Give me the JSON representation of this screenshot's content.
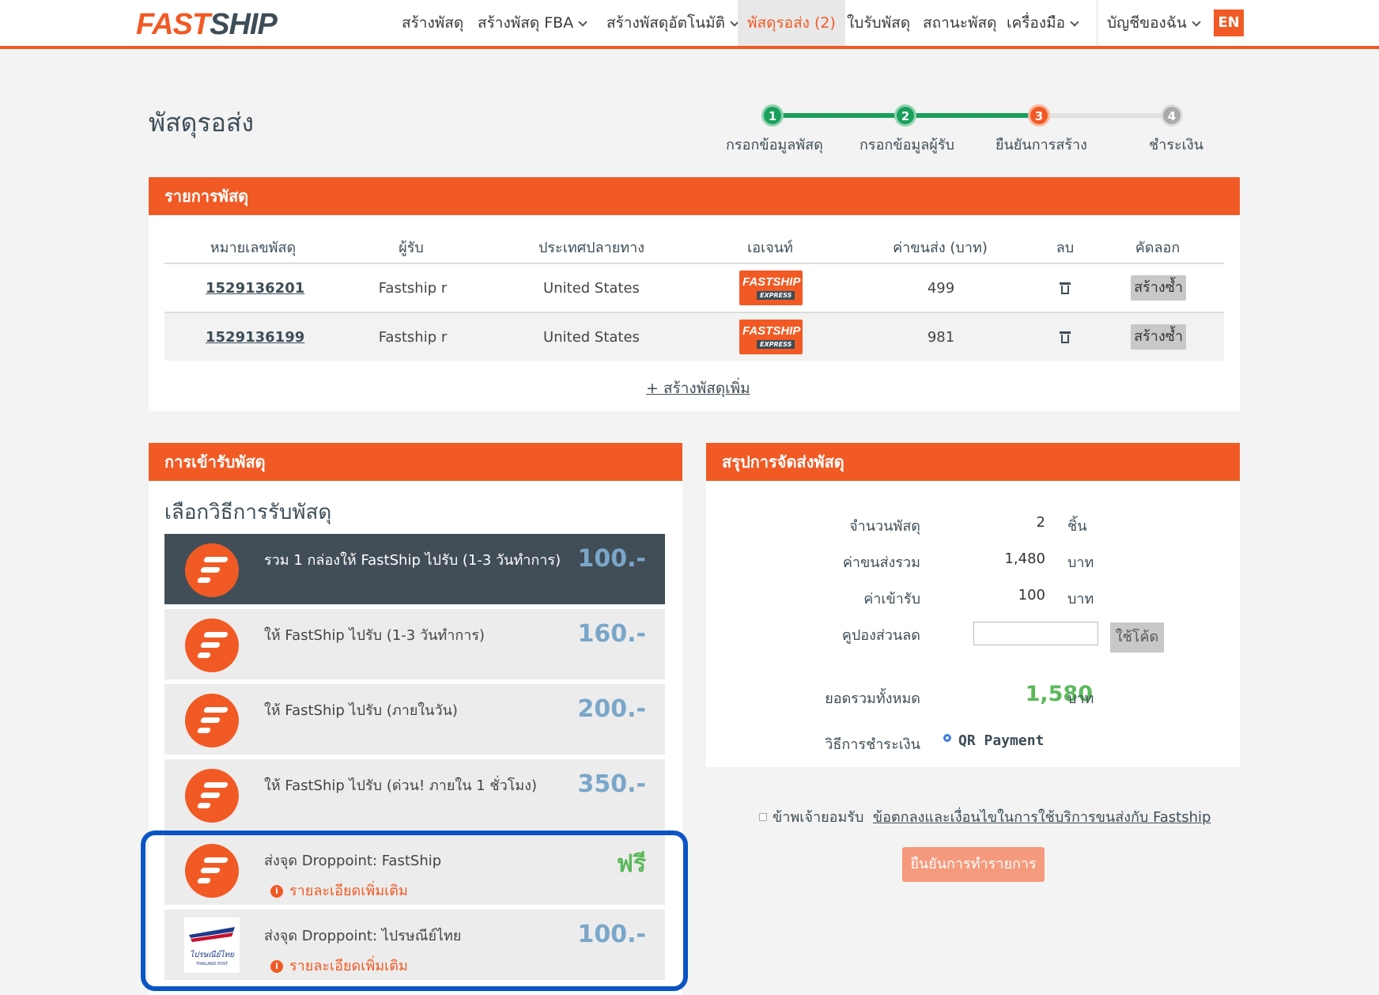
{
  "brand": {
    "logo_part1": "FAST",
    "logo_part2": "SHIP",
    "accent": "#f15a24",
    "dark": "#3d4d57",
    "success": "#5cb85c"
  },
  "nav": {
    "items": [
      {
        "label": "สร้างพัสดุ"
      },
      {
        "label": "สร้างพัสดุ FBA"
      },
      {
        "label": "สร้างพัสดุอัตโนมัติ"
      },
      {
        "label": "พัสดุรอส่ง (2)"
      },
      {
        "label": "ใบรับพัสดุ"
      },
      {
        "label": "สถานะพัสดุ"
      },
      {
        "label": "เครื่องมือ"
      },
      {
        "label": "บัญชีของฉัน"
      }
    ],
    "lang": "EN"
  },
  "page": {
    "title": "พัสดุรอส่ง"
  },
  "stepper": {
    "steps": [
      {
        "num": "1",
        "label": "กรอกข้อมูลพัสดุ"
      },
      {
        "num": "2",
        "label": "กรอกข้อมูลผู้รับ"
      },
      {
        "num": "3",
        "label": "ยืนยันการสร้าง"
      },
      {
        "num": "4",
        "label": "ชำระเงิน"
      }
    ]
  },
  "parcels": {
    "title": "รายการพัสดุ",
    "headers": [
      "หมายเลขพัสดุ",
      "ผู้รับ",
      "ประเทศปลายทาง",
      "เอเจนท์",
      "ค่าขนส่ง (บาท)",
      "ลบ",
      "คัดลอก"
    ],
    "rows": [
      {
        "id": "1529136201",
        "recipient": "Fastship r",
        "country": "United States",
        "agent_top": "FASTSHIP",
        "agent_bottom": "EXPRESS",
        "cost": "499",
        "copy": "สร้างซ้ำ"
      },
      {
        "id": "1529136199",
        "recipient": "Fastship r",
        "country": "United States",
        "agent_top": "FASTSHIP",
        "agent_bottom": "EXPRESS",
        "cost": "981",
        "copy": "สร้างซ้ำ"
      }
    ],
    "add_more": "+ สร้างพัสดุเพิ่ม"
  },
  "pickup": {
    "title": "การเข้ารับพัสดุ",
    "subtitle": "เลือกวิธีการรับพัสดุ",
    "options": [
      {
        "label": "รวม 1 กล่องให้ FastShip ไปรับ (1-3 วันทำการ)",
        "price": "100.-"
      },
      {
        "label": "ให้ FastShip ไปรับ (1-3 วันทำการ)",
        "price": "160.-"
      },
      {
        "label": "ให้ FastShip ไปรับ (ภายในวัน)",
        "price": "200.-"
      },
      {
        "label": "ให้ FastShip ไปรับ (ด่วน! ภายใน 1 ชั่วโมง)",
        "price": "350.-"
      },
      {
        "label": "ส่งจุด Droppoint: FastShip",
        "price": "ฟรี",
        "more": "รายละเอียดเพิ่มเติม"
      },
      {
        "label": "ส่งจุด Droppoint: ไปรษณีย์ไทย",
        "price": "100.-",
        "more": "รายละเอียดเพิ่มเติม",
        "logo_text": "ไปรษณีย์ไทย",
        "logo_sub": "THAILAND POST"
      }
    ],
    "info_icon": "i"
  },
  "summary": {
    "title": "สรุปการจัดส่งพัสดุ",
    "count_label": "จำนวนพัสดุ",
    "count_value": "2",
    "count_unit": "ชิ้น",
    "shipping_label": "ค่าขนส่งรวม",
    "shipping_value": "1,480",
    "shipping_unit": "บาท",
    "pickup_label": "ค่าเข้ารับ",
    "pickup_value": "100",
    "pickup_unit": "บาท",
    "coupon_label": "คูปองส่วนลด",
    "coupon_value": "",
    "coupon_button": "ใช้โค้ด",
    "total_label": "ยอดรวมทั้งหมด",
    "total_value": "1,580",
    "total_unit": "บาท",
    "payment_label": "วิธีการชำระเงิน",
    "payment_option": "QR Payment"
  },
  "terms": {
    "prefix": "ข้าพเจ้ายอมรับ",
    "link": "ข้อตกลงและเงื่อนไขในการใช้บริการขนส่งกับ Fastship"
  },
  "confirm_button": "ยืนยันการทำรายการ"
}
